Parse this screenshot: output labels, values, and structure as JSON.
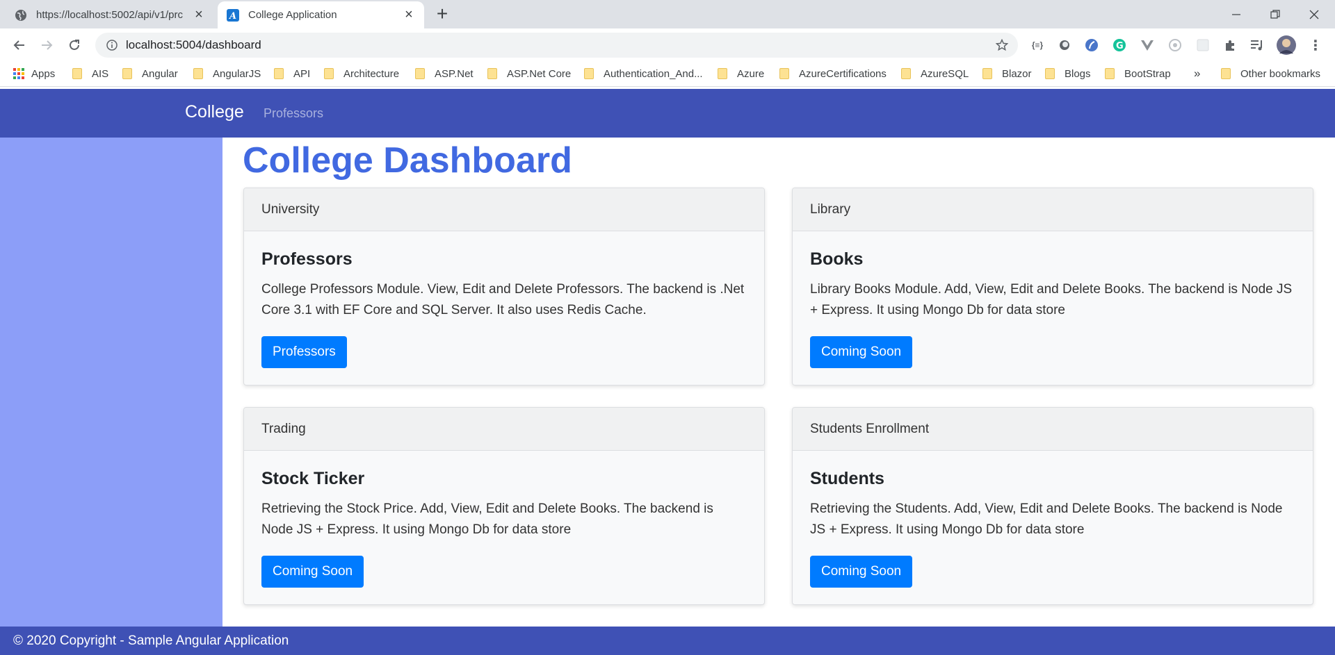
{
  "browser": {
    "tabs": [
      {
        "title": "https://localhost:5002/api/v1/prc",
        "active": false
      },
      {
        "title": "College Application",
        "active": true
      }
    ],
    "url": "localhost:5004/dashboard",
    "bookmarks": {
      "apps_label": "Apps",
      "folders": [
        "AIS",
        "Angular",
        "AngularJS",
        "API",
        "Architecture",
        "ASP.Net",
        "ASP.Net Core",
        "Authentication_And...",
        "Azure",
        "AzureCertifications",
        "AzureSQL",
        "Blazor",
        "Blogs",
        "BootStrap"
      ],
      "overflow": "»",
      "other": "Other bookmarks"
    }
  },
  "app": {
    "brand": "College",
    "nav_link": "Professors",
    "page_title": "College Dashboard",
    "cards": [
      {
        "header": "University",
        "title": "Professors",
        "text": "College Professors Module. View, Edit and Delete Professors. The backend is .Net Core 3.1 with EF Core and SQL Server. It also uses Redis Cache.",
        "button": "Professors"
      },
      {
        "header": "Library",
        "title": "Books",
        "text": "Library Books Module. Add, View, Edit and Delete Books. The backend is Node JS + Express. It using Mongo Db for data store",
        "button": "Coming Soon"
      },
      {
        "header": "Trading",
        "title": "Stock Ticker",
        "text": "Retrieving the Stock Price. Add, View, Edit and Delete Books. The backend is Node JS + Express. It using Mongo Db for data store",
        "button": "Coming Soon"
      },
      {
        "header": "Students Enrollment",
        "title": "Students",
        "text": "Retrieving the Students. Add, View, Edit and Delete Books. The backend is Node JS + Express. It using Mongo Db for data store",
        "button": "Coming Soon"
      }
    ],
    "footer": "© 2020 Copyright - Sample Angular Application"
  },
  "colors": {
    "navbar": "#3f51b5",
    "sidebar": "#8c9ef8",
    "title": "#4169e1",
    "button": "#007bff"
  }
}
